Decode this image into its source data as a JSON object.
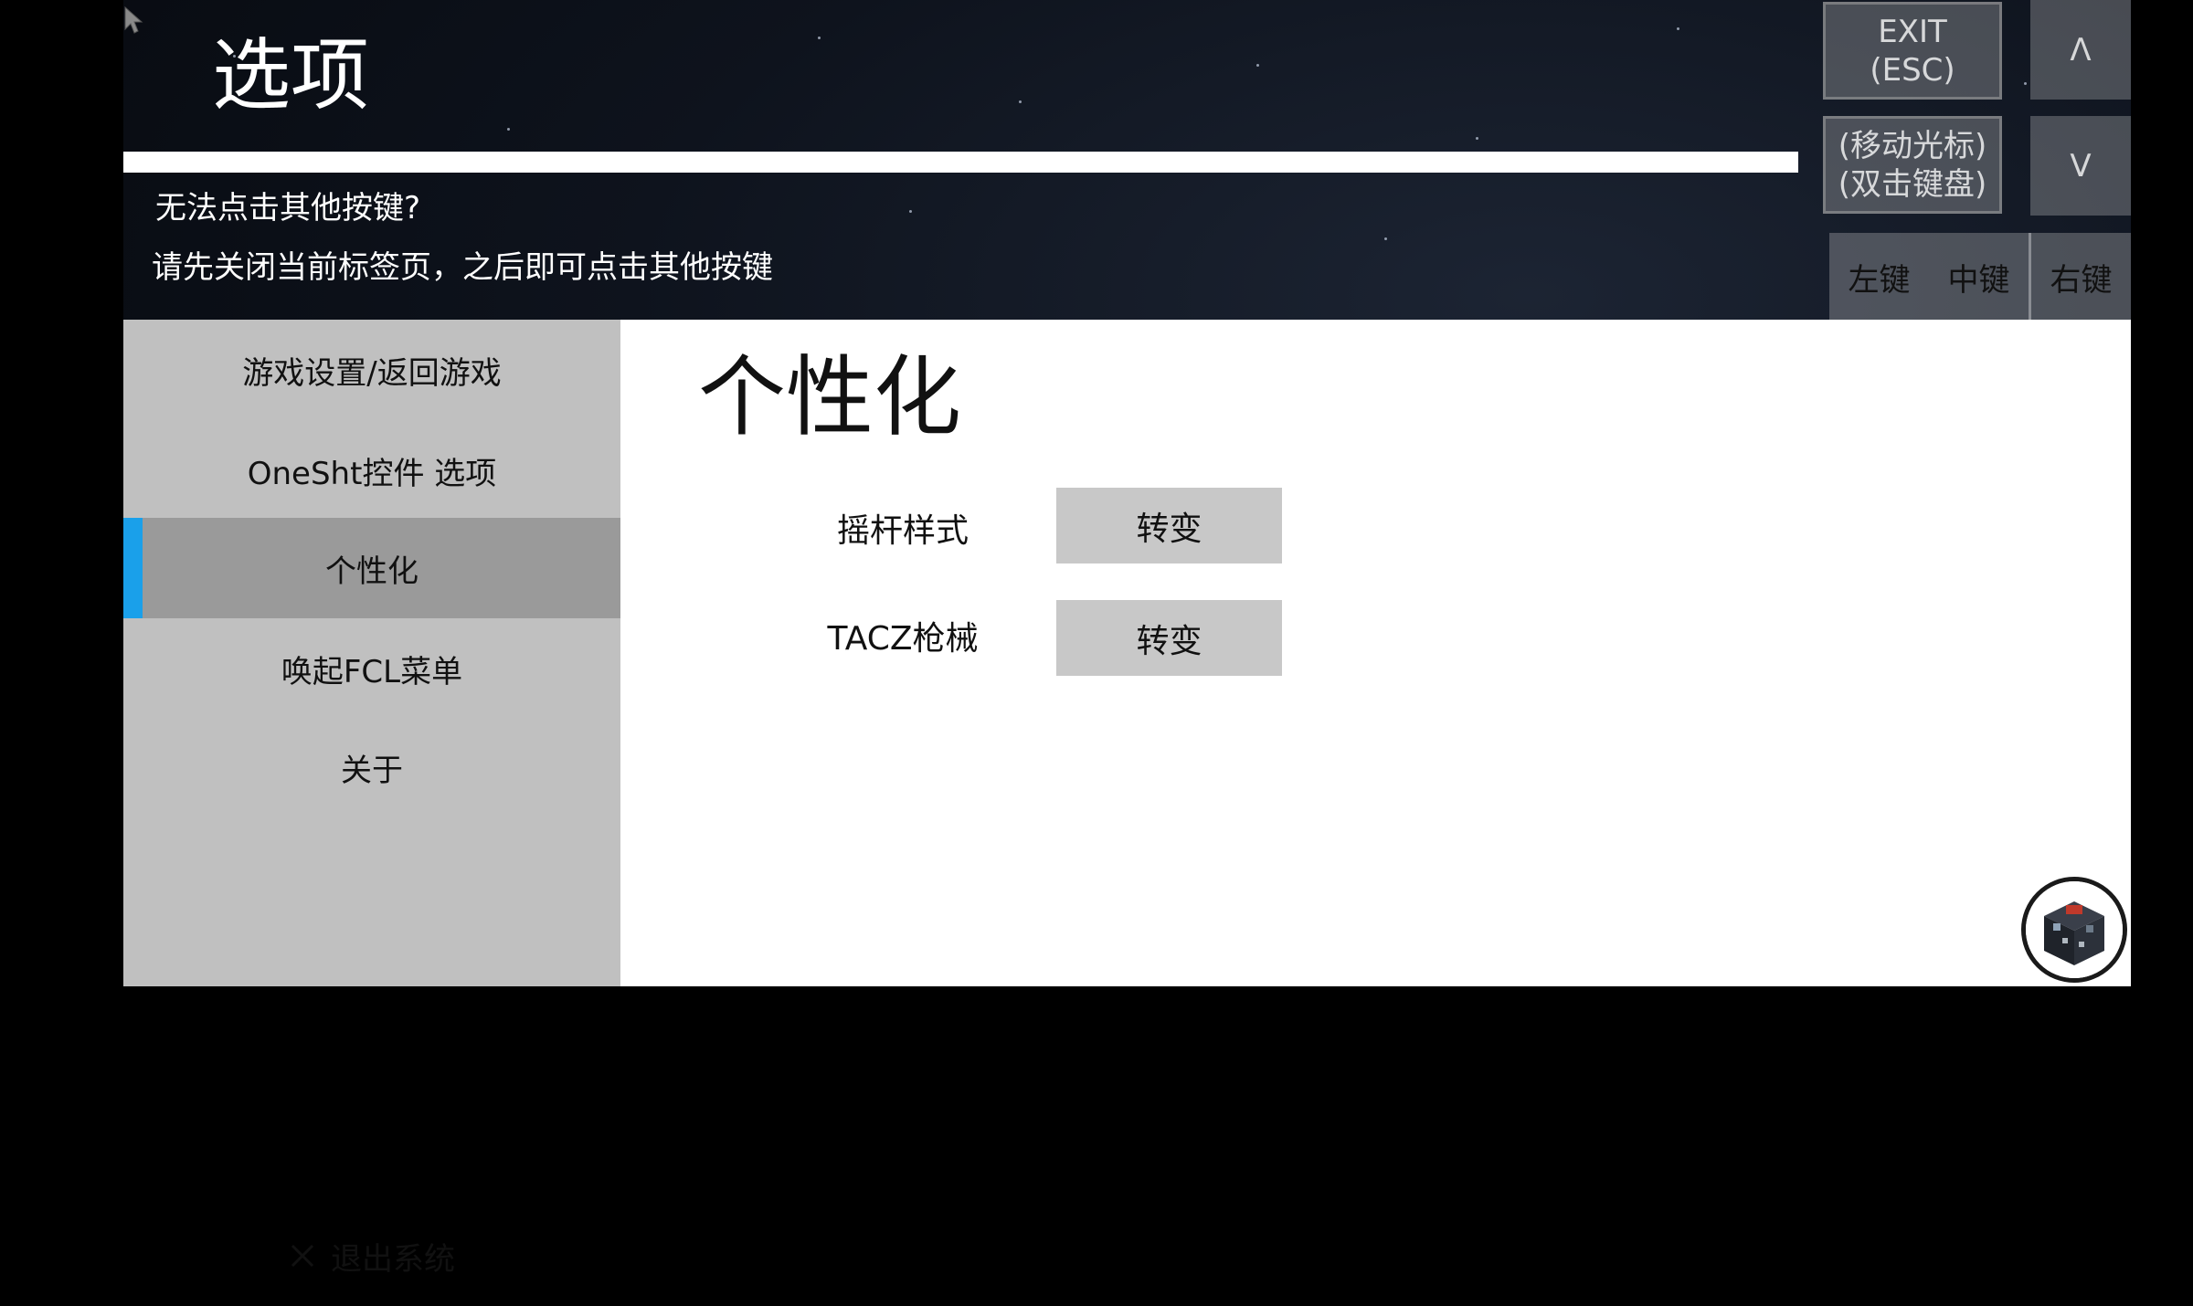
{
  "header": {
    "title": "选项",
    "hint_question": "无法点击其他按键?",
    "hint_answer": "请先关闭当前标签页，之后即可点击其他按键"
  },
  "overlay": {
    "exit_label": "EXIT\n(ESC)",
    "cursor_label": "(移动光标)\n(双击键盘)",
    "up_label": "Λ",
    "down_label": "V",
    "mouse": {
      "left": "左键",
      "middle": "中键",
      "right": "右键"
    }
  },
  "sidebar": {
    "items": [
      {
        "label": "游戏设置/返回游戏"
      },
      {
        "label": "OneSht控件  选项"
      },
      {
        "label": "个性化",
        "active": true
      },
      {
        "label": "唤起FCL菜单"
      },
      {
        "label": "关于"
      }
    ],
    "exit_label": "退出系统"
  },
  "main": {
    "section_title": "个性化",
    "rows": [
      {
        "label": "摇杆样式",
        "button": "转变"
      },
      {
        "label": "TACZ枪械",
        "button": "转变"
      }
    ]
  },
  "colors": {
    "accent": "#1aa0ea",
    "sidebar_bg": "#c0c0c0",
    "sidebar_active": "#9a9a9a",
    "button_bg": "#c8c8c8"
  },
  "icons": {
    "cursor": "cursor-arrow-icon",
    "exit": "close-icon",
    "launcher": "fcl-launcher-icon"
  }
}
